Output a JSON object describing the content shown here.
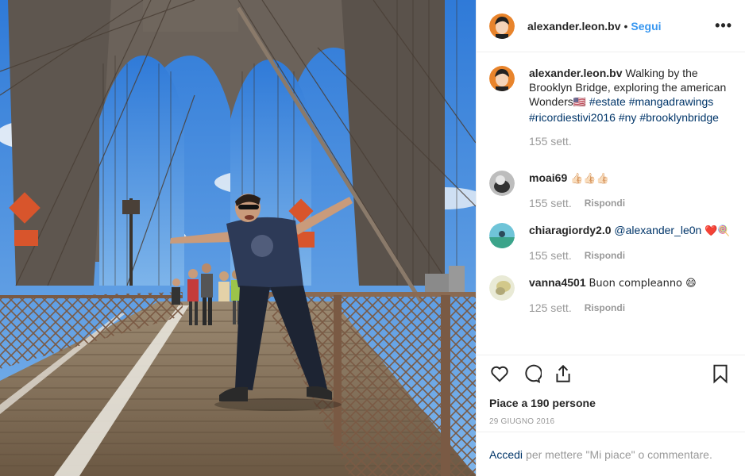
{
  "post": {
    "username": "alexander.leon.bv",
    "follow_label": "Segui",
    "more_label": "•••",
    "separator": "•"
  },
  "caption": {
    "username": "alexander.leon.bv",
    "text": "Walking by the Brooklyn Bridge, exploring the american Wonders",
    "flag": "🇺🇸",
    "hashtags": [
      "#estate",
      "#mangadrawings",
      "#ricordiestivi2016",
      "#ny",
      "#brooklynbridge"
    ],
    "time": "155 sett."
  },
  "comments": [
    {
      "username": "moai69",
      "text": "👍🏻👍🏻👍🏻",
      "time": "155 sett.",
      "reply": "Rispondi",
      "avatar_color": "#cfcfcf"
    },
    {
      "username": "chiaragiordy2.0",
      "mention": "@alexander_le0n",
      "text": "❤️🍭",
      "time": "155 sett.",
      "reply": "Rispondi",
      "avatar_color": "#6fc4d8"
    },
    {
      "username": "vanna4501",
      "text": "Buon compleanno 😄",
      "time": "125 sett.",
      "reply": "Rispondi",
      "avatar_color": "#e9ead6"
    }
  ],
  "actions": {
    "like_icon": "heart-icon",
    "comment_icon": "comment-icon",
    "share_icon": "share-icon",
    "save_icon": "bookmark-icon"
  },
  "likes_text": "Piace a 190 persone",
  "date_text": "29 GIUGNO 2016",
  "login": {
    "link": "Accedi",
    "text": "per mettere \"Mi piace\" o commentare."
  },
  "colors": {
    "link_blue": "#3897f0",
    "hashtag": "#003569",
    "muted": "#999999",
    "text": "#262626"
  }
}
